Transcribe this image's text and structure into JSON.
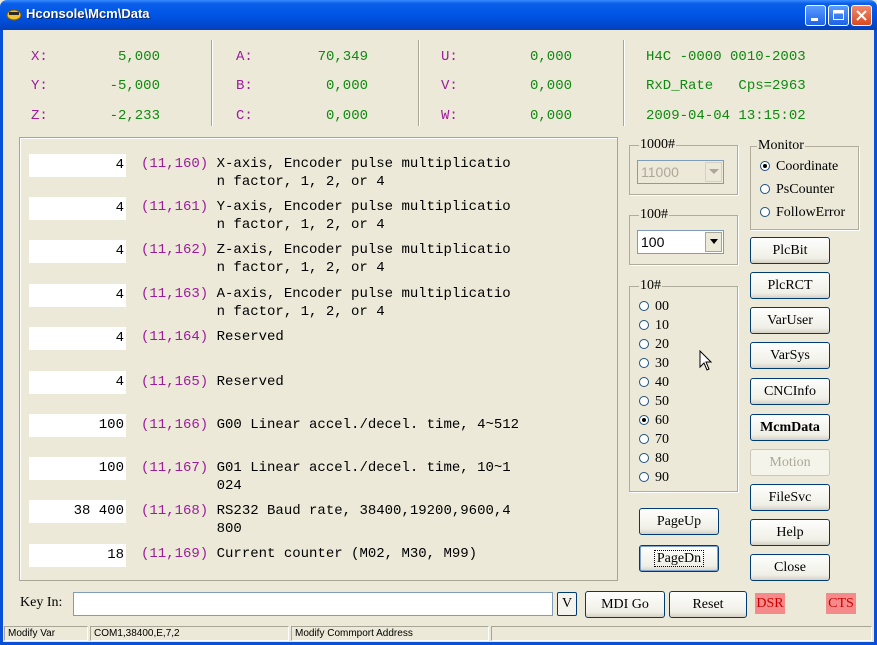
{
  "window": {
    "title": "Hconsole\\Mcm\\Data"
  },
  "axes_left": [
    {
      "label": "X:",
      "value": "5,000"
    },
    {
      "label": "Y:",
      "value": "-5,000"
    },
    {
      "label": "Z:",
      "value": "-2,233"
    }
  ],
  "axes_mid": [
    {
      "label": "A:",
      "value": "70,349"
    },
    {
      "label": "B:",
      "value": "0,000"
    },
    {
      "label": "C:",
      "value": "0,000"
    }
  ],
  "axes_right": [
    {
      "label": "U:",
      "value": "0,000"
    },
    {
      "label": "V:",
      "value": "0,000"
    },
    {
      "label": "W:",
      "value": "0,000"
    }
  ],
  "info": {
    "line1": "H4C -0000 0010-2003",
    "line2": "RxD_Rate   Cps=2963",
    "line3": "2009-04-04 13:15:02"
  },
  "params": [
    {
      "value": "4",
      "code": "(11,160)",
      "desc": " X-axis, Encoder pulse multiplicatio\n         n factor, 1, 2, or 4"
    },
    {
      "value": "4",
      "code": "(11,161)",
      "desc": " Y-axis, Encoder pulse multiplicatio\n         n factor, 1, 2, or 4"
    },
    {
      "value": "4",
      "code": "(11,162)",
      "desc": " Z-axis, Encoder pulse multiplicatio\n         n factor, 1, 2, or 4"
    },
    {
      "value": "4",
      "code": "(11,163)",
      "desc": " A-axis, Encoder pulse multiplicatio\n         n factor, 1, 2, or 4"
    },
    {
      "value": "4",
      "code": "(11,164)",
      "desc": " Reserved"
    },
    {
      "value": "4",
      "code": "(11,165)",
      "desc": " Reserved"
    },
    {
      "value": "100",
      "code": "(11,166)",
      "desc": " G00 Linear accel./decel. time, 4~512"
    },
    {
      "value": "100",
      "code": "(11,167)",
      "desc": " G01 Linear accel./decel. time, 10~1\n         024"
    },
    {
      "value": "38 400",
      "code": "(11,168)",
      "desc": " RS232 Baud rate, 38400,19200,9600,4\n         800"
    },
    {
      "value": "18",
      "code": "(11,169)",
      "desc": " Current counter (M02, M30, M99)"
    }
  ],
  "g1000": {
    "label": "1000#",
    "value": "11000"
  },
  "g100": {
    "label": "100#",
    "value": "100"
  },
  "g10": {
    "label": "10#",
    "options": [
      "00",
      "10",
      "20",
      "30",
      "40",
      "50",
      "60",
      "70",
      "80",
      "90"
    ],
    "selected": "60"
  },
  "monitor": {
    "label": "Monitor",
    "options": [
      "Coordinate",
      "PsCounter",
      "FollowError"
    ],
    "selected": "Coordinate"
  },
  "buttons": {
    "plcbit": "PlcBit",
    "plcrct": "PlcRCT",
    "varuser": "VarUser",
    "varsys": "VarSys",
    "cncinfo": "CNCInfo",
    "mcmdata": "McmData",
    "motion": "Motion",
    "filesvc": "FileSvc",
    "help": "Help",
    "close": "Close",
    "pageup": "PageUp",
    "pagedn": "PageDn",
    "mdigo": "MDI Go",
    "reset": "Reset",
    "v": "V"
  },
  "keyin": {
    "label": "Key In:",
    "value": ""
  },
  "leds": {
    "dsr": "DSR",
    "cts": "CTS"
  },
  "status": {
    "p1": "Modify Var",
    "p2": "COM1,38400,E,7,2",
    "p3": "Modify Commport Address",
    "p4": ""
  },
  "colors": {
    "label": "#9c1c9c",
    "value": "#108a10",
    "led": "#f58a8a",
    "titlebar": "#0055e5"
  }
}
